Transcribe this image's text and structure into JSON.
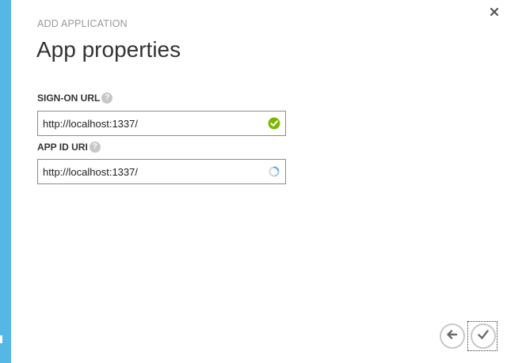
{
  "dialog": {
    "wizard_title": "ADD APPLICATION",
    "page_title": "App properties"
  },
  "fields": {
    "signon_url": {
      "label": "SIGN-ON URL",
      "value": "http://localhost:1337/",
      "help_icon": "help-icon",
      "status_icon": "check-circle-icon",
      "status_color": "#7ab800"
    },
    "app_id_uri": {
      "label": "APP ID URI",
      "value": "http://localhost:1337/",
      "help_icon": "help-icon",
      "status_icon": "spinner-icon",
      "status_color": "#5aa9e6"
    }
  },
  "navigation": {
    "back_icon": "arrow-left-icon",
    "complete_icon": "checkmark-icon",
    "close_icon": "close-icon"
  },
  "colors": {
    "accent_strip": "#54b7e6",
    "button_border": "#c8c8c8",
    "icon_gray": "#6b6b6b"
  }
}
